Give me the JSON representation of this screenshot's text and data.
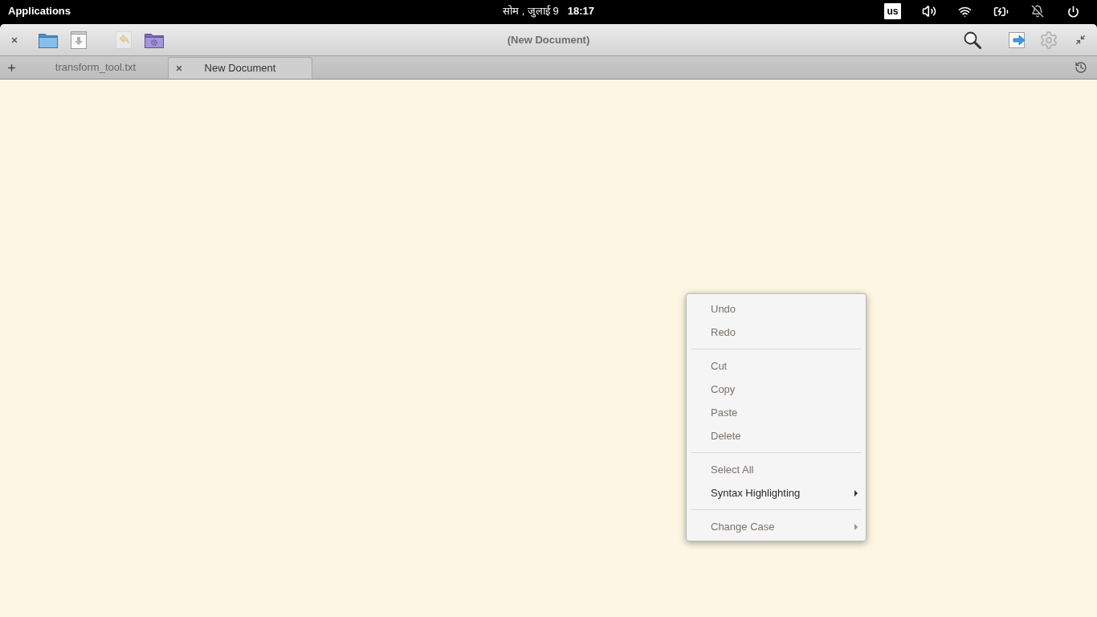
{
  "top_panel": {
    "applications": "Applications",
    "date": "सोम , जुलाई 9",
    "time": "18:17",
    "keyboard_layout": "us"
  },
  "window": {
    "title": "(New Document)"
  },
  "toolbar": {
    "left": [
      {
        "kind": "open",
        "disabled": false
      },
      {
        "kind": "save",
        "disabled": false
      },
      {
        "kind": "revert",
        "disabled": true
      },
      {
        "kind": "project",
        "disabled": false
      }
    ],
    "right": [
      {
        "kind": "search"
      },
      {
        "kind": "share"
      },
      {
        "kind": "settings"
      },
      {
        "kind": "restore"
      }
    ]
  },
  "tabs": [
    {
      "label": "transform_tool.txt",
      "selected": false
    },
    {
      "label": "New Document",
      "selected": true
    }
  ],
  "context_menu": {
    "items": [
      {
        "kind": "item",
        "label": "Undo",
        "disabled": true
      },
      {
        "kind": "item",
        "label": "Redo",
        "disabled": true
      },
      {
        "kind": "separator"
      },
      {
        "kind": "item",
        "label": "Cut",
        "disabled": true
      },
      {
        "kind": "item",
        "label": "Copy",
        "disabled": true
      },
      {
        "kind": "item",
        "label": "Paste",
        "disabled": true
      },
      {
        "kind": "item",
        "label": "Delete",
        "disabled": true
      },
      {
        "kind": "separator"
      },
      {
        "kind": "item",
        "label": "Select All",
        "disabled": true
      },
      {
        "kind": "submenu",
        "label": "Syntax Highlighting",
        "disabled": false
      },
      {
        "kind": "separator"
      },
      {
        "kind": "submenu",
        "label": "Change Case",
        "disabled": true
      }
    ]
  }
}
